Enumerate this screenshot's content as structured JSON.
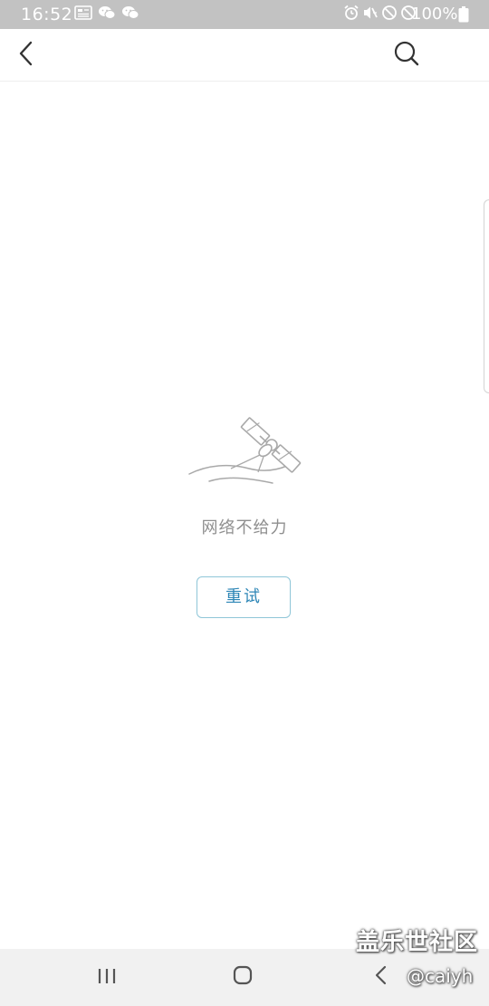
{
  "status_bar": {
    "time": "16:52",
    "battery_percent": "100%",
    "left_icons": [
      "toutiao-news-icon",
      "wechat-icon",
      "wechat-icon"
    ],
    "right_icons": [
      "alarm-icon",
      "mute-icon",
      "do-not-disturb-icon",
      "do-not-disturb-icon",
      "battery-icon"
    ]
  },
  "app_bar": {
    "back_icon": "chevron-left-icon",
    "search_icon": "search-icon"
  },
  "error_state": {
    "illustration": "satellite-icon",
    "message": "网络不给力",
    "retry_label": "重试"
  },
  "watermark": {
    "title": "盖乐世社区",
    "user": "@caiyh"
  },
  "nav_bar": {
    "recent_icon": "recent-apps-icon",
    "home_icon": "home-icon",
    "back_icon": "back-icon"
  },
  "colors": {
    "status_bar_bg": "#c2c2c2",
    "accent": "#2d86b6",
    "button_border": "#8fc6d8",
    "message_text": "#8f8f8f",
    "nav_bar_bg": "#f1f1f1"
  }
}
